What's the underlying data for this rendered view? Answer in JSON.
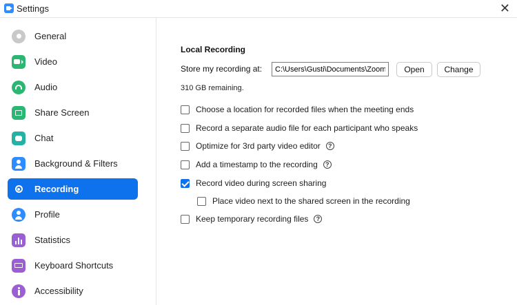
{
  "window": {
    "title": "Settings",
    "close_glyph": "✕"
  },
  "sidebar": {
    "items": [
      {
        "label": "General",
        "icon": "gear-icon",
        "color": "#c9c9c9"
      },
      {
        "label": "Video",
        "icon": "video-icon",
        "color": "#2bb673"
      },
      {
        "label": "Audio",
        "icon": "headphones-icon",
        "color": "#2bb673"
      },
      {
        "label": "Share Screen",
        "icon": "share-screen-icon",
        "color": "#2bb673"
      },
      {
        "label": "Chat",
        "icon": "chat-icon",
        "color": "#23b2a3"
      },
      {
        "label": "Background & Filters",
        "icon": "person-background-icon",
        "color": "#2d8cff"
      },
      {
        "label": "Recording",
        "icon": "record-icon",
        "color": "#ffffff",
        "active": true
      },
      {
        "label": "Profile",
        "icon": "profile-icon",
        "color": "#2d8cff"
      },
      {
        "label": "Statistics",
        "icon": "statistics-icon",
        "color": "#9b5fd3"
      },
      {
        "label": "Keyboard Shortcuts",
        "icon": "keyboard-icon",
        "color": "#9b5fd3"
      },
      {
        "label": "Accessibility",
        "icon": "accessibility-icon",
        "color": "#9b5fd3"
      }
    ]
  },
  "recording": {
    "section_title": "Local Recording",
    "store_label": "Store my recording at:",
    "path_value": "C:\\Users\\Gusti\\Documents\\Zoom",
    "open_label": "Open",
    "change_label": "Change",
    "remaining": "310 GB remaining.",
    "options": [
      {
        "label": "Choose a location for recorded files when the meeting ends",
        "checked": false,
        "help": false,
        "indent": false
      },
      {
        "label": "Record a separate audio file for each participant who speaks",
        "checked": false,
        "help": false,
        "indent": false
      },
      {
        "label": "Optimize for 3rd party video editor",
        "checked": false,
        "help": true,
        "indent": false
      },
      {
        "label": "Add a timestamp to the recording",
        "checked": false,
        "help": true,
        "indent": false
      },
      {
        "label": "Record video during screen sharing",
        "checked": true,
        "help": false,
        "indent": false
      },
      {
        "label": "Place video next to the shared screen in the recording",
        "checked": false,
        "help": false,
        "indent": true
      },
      {
        "label": "Keep temporary recording files",
        "checked": false,
        "help": true,
        "indent": false
      }
    ],
    "help_glyph": "?"
  },
  "colors": {
    "accent": "#0e72ed"
  }
}
